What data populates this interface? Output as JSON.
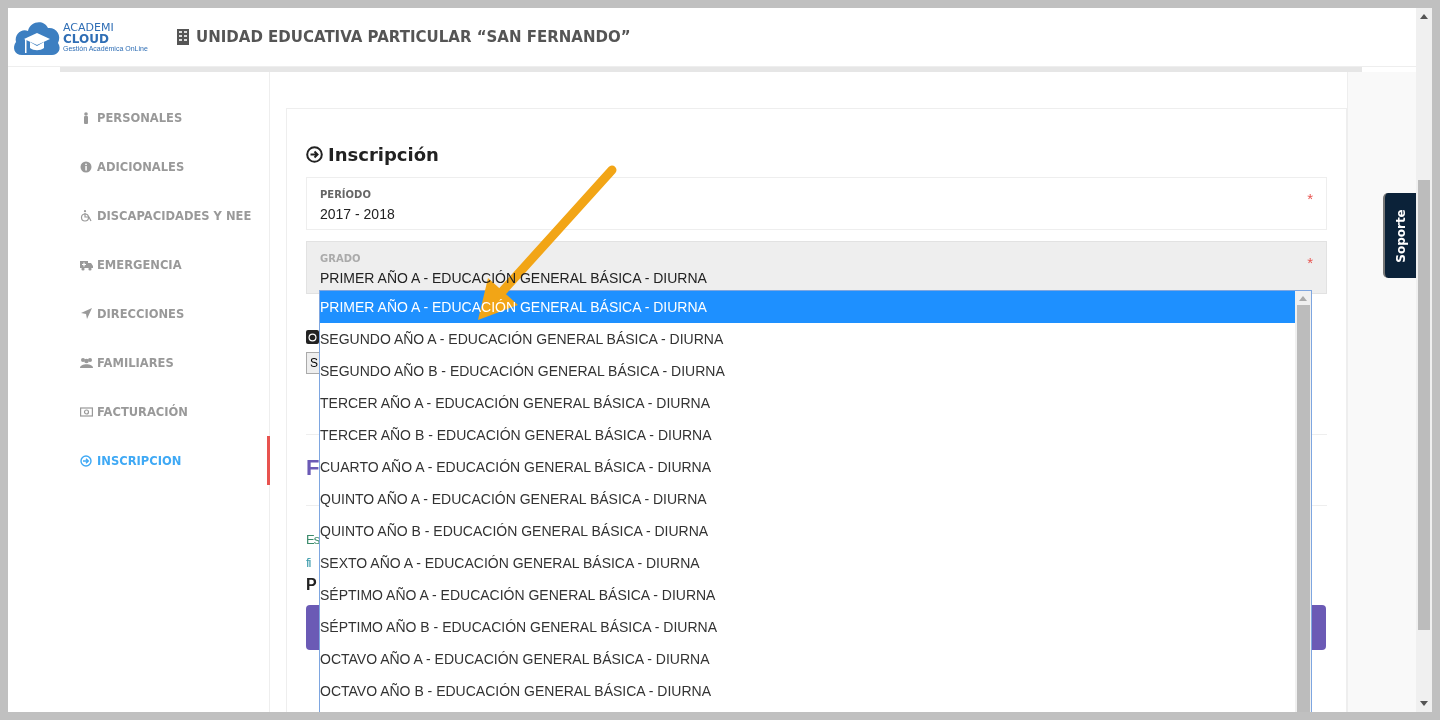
{
  "header": {
    "logo_top": "ACADEMI",
    "logo_bottom": "CLOUD",
    "logo_tagline": "Gestión Académica OnLine",
    "school": "UNIDAD EDUCATIVA PARTICULAR “SAN FERNANDO”"
  },
  "sidebar": {
    "items": [
      {
        "label": "PERSONALES",
        "kind": "person",
        "selected": false
      },
      {
        "label": "ADICIONALES",
        "kind": "info",
        "selected": false
      },
      {
        "label": "DISCAPACIDADES Y NEE",
        "kind": "wheelchair",
        "selected": false
      },
      {
        "label": "EMERGENCIA",
        "kind": "ambulance",
        "selected": false
      },
      {
        "label": "DIRECCIONES",
        "kind": "location",
        "selected": false
      },
      {
        "label": "FAMILIARES",
        "kind": "users",
        "selected": false
      },
      {
        "label": "FACTURACIÓN",
        "kind": "money",
        "selected": false
      },
      {
        "label": "INSCRIPCION",
        "kind": "circle-arrow",
        "selected": true
      }
    ]
  },
  "section": {
    "title": "Inscripción",
    "fields": [
      {
        "label": "PERÍODO",
        "value": "2017 - 2018",
        "required": "*",
        "disabled": false
      },
      {
        "label": "GRADO",
        "value": "PRIMER AÑO A - EDUCACIÓN GENERAL BÁSICA - DIURNA",
        "required": "*",
        "disabled": true
      }
    ],
    "dropdown": {
      "options": [
        {
          "label": "PRIMER AÑO A - EDUCACIÓN GENERAL BÁSICA - DIURNA",
          "selected": true
        },
        {
          "label": "SEGUNDO AÑO A - EDUCACIÓN GENERAL BÁSICA - DIURNA",
          "selected": false
        },
        {
          "label": "SEGUNDO AÑO B - EDUCACIÓN GENERAL BÁSICA - DIURNA",
          "selected": false
        },
        {
          "label": "TERCER AÑO A - EDUCACIÓN GENERAL BÁSICA - DIURNA",
          "selected": false
        },
        {
          "label": "TERCER AÑO B - EDUCACIÓN GENERAL BÁSICA - DIURNA",
          "selected": false
        },
        {
          "label": "CUARTO AÑO A - EDUCACIÓN GENERAL BÁSICA - DIURNA",
          "selected": false
        },
        {
          "label": "QUINTO AÑO A - EDUCACIÓN GENERAL BÁSICA - DIURNA",
          "selected": false
        },
        {
          "label": "QUINTO AÑO B - EDUCACIÓN GENERAL BÁSICA - DIURNA",
          "selected": false
        },
        {
          "label": "SEXTO AÑO A - EDUCACIÓN GENERAL BÁSICA - DIURNA",
          "selected": false
        },
        {
          "label": "SÉPTIMO AÑO A - EDUCACIÓN GENERAL BÁSICA - DIURNA",
          "selected": false
        },
        {
          "label": "SÉPTIMO AÑO B - EDUCACIÓN GENERAL BÁSICA - DIURNA",
          "selected": false
        },
        {
          "label": "OCTAVO AÑO A - EDUCACIÓN GENERAL BÁSICA - DIURNA",
          "selected": false
        },
        {
          "label": "OCTAVO AÑO B - EDUCACIÓN GENERAL BÁSICA - DIURNA",
          "selected": false
        }
      ]
    },
    "hidden_parts": {
      "button_1": "S",
      "heading": "F",
      "paragraph_line_1": "Es",
      "paragraph_line_2": "fi",
      "bold_line": "P"
    }
  },
  "support_tab": "Soporte"
}
